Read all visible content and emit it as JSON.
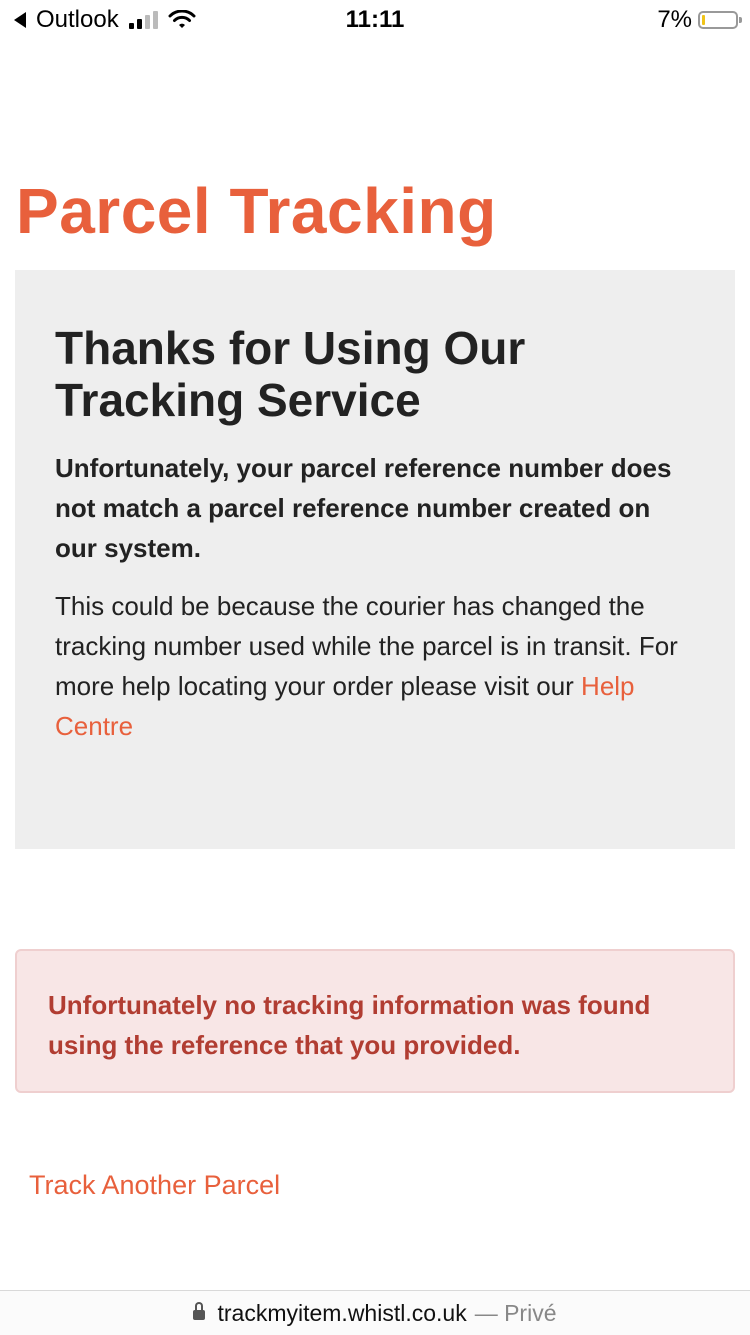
{
  "status_bar": {
    "back_app": "Outlook",
    "time": "11:11",
    "battery_percent": "7%",
    "battery_level": 0.07
  },
  "page": {
    "title": "Parcel Tracking"
  },
  "info_box": {
    "heading": "Thanks for Using Our Tracking Service",
    "strong_text": "Unfortunately, your parcel reference number does not match a parcel reference number created on our system.",
    "body_text": "This could be because the courier has changed the tracking number used while the parcel is in transit. For more help locating your order please visit our ",
    "help_link_label": "Help Centre"
  },
  "alert": {
    "message": "Unfortunately no tracking information was found using the reference that you provided."
  },
  "actions": {
    "track_another_label": "Track Another Parcel"
  },
  "browser": {
    "domain": "trackmyitem.whistl.co.uk",
    "private_label": "— Privé"
  },
  "colors": {
    "accent": "#e8603c",
    "alert_text": "#b13d32",
    "alert_bg": "#f8e6e6",
    "info_bg": "#eeeeee"
  },
  "icons": [
    "back-arrow-icon",
    "cellular-signal-icon",
    "wifi-icon",
    "battery-icon",
    "lock-icon"
  ]
}
